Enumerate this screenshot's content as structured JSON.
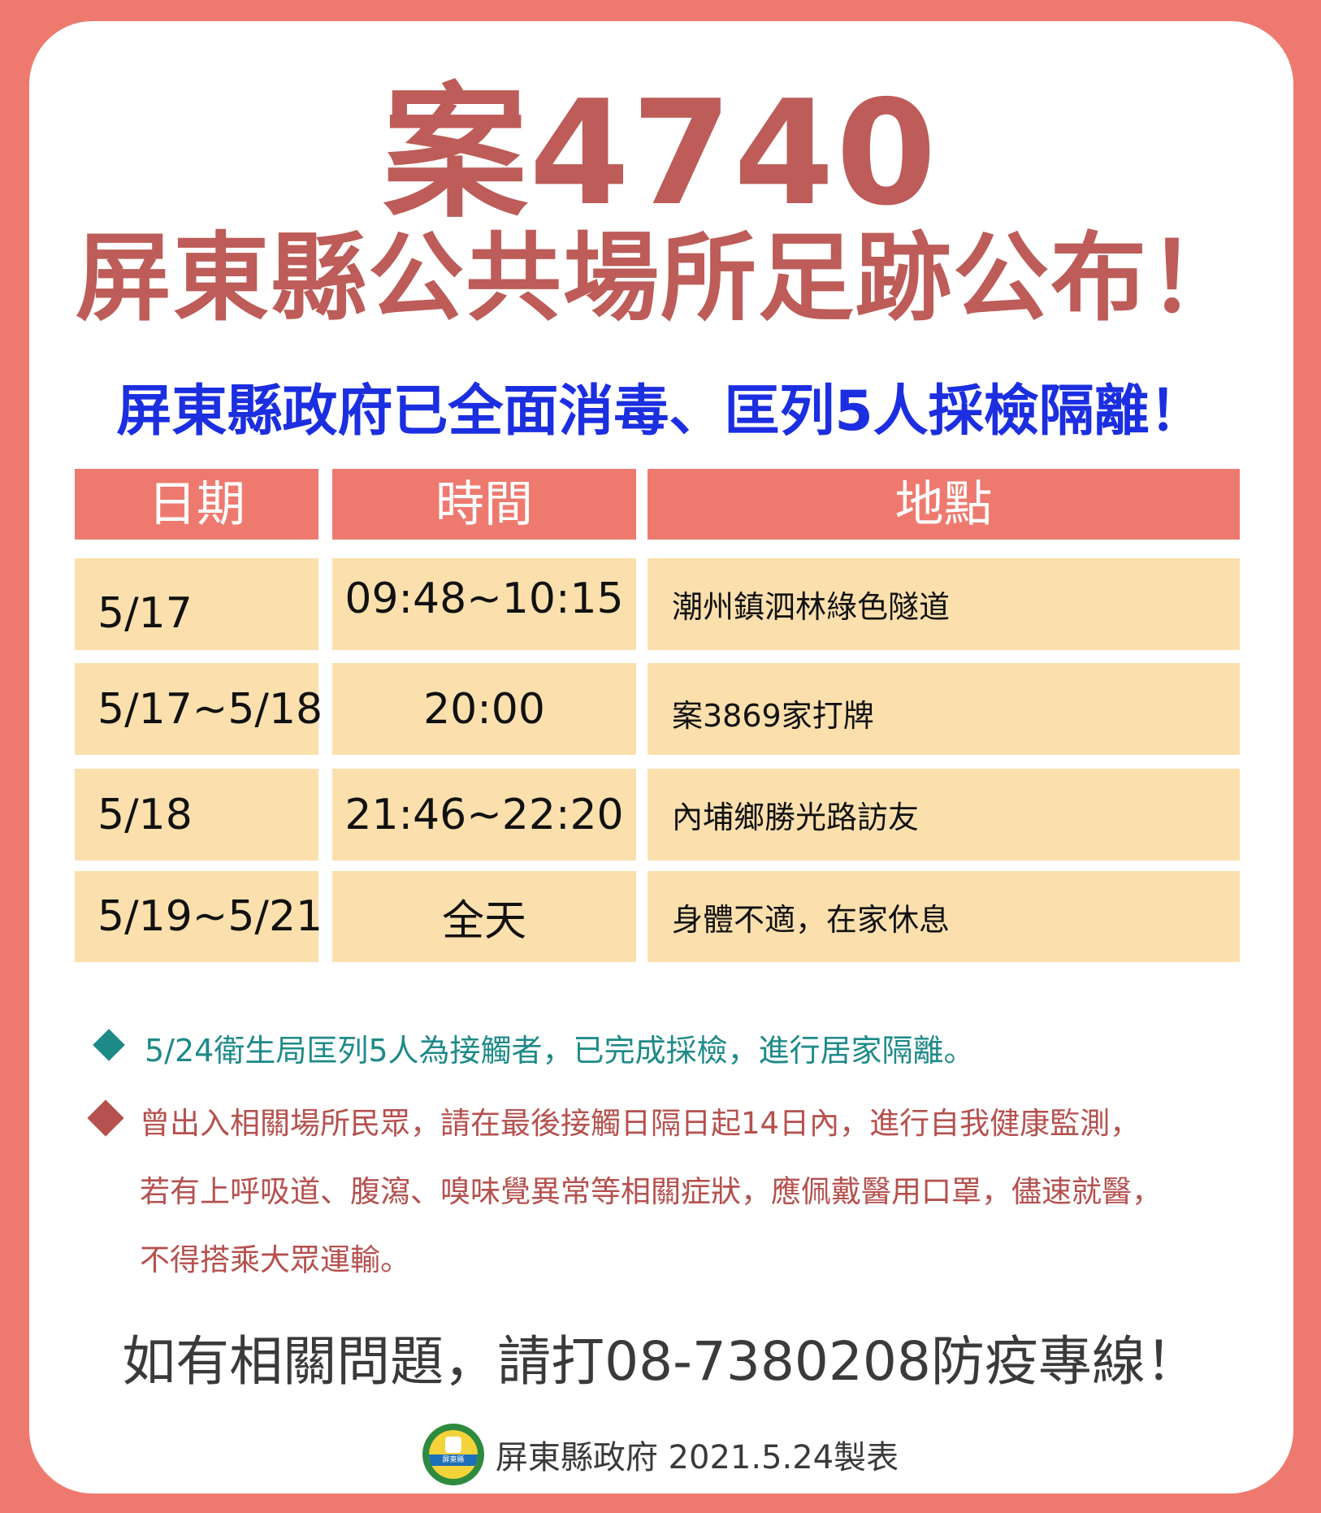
{
  "title": {
    "case": "案4740",
    "main": "屏東縣公共場所足跡公布！"
  },
  "subtitle": "屏東縣政府已全面消毒、匡列5人採檢隔離！",
  "table": {
    "headers": [
      "日期",
      "時間",
      "地點"
    ],
    "rows": [
      {
        "date": "5/17",
        "time": "09:48~10:15",
        "location": "潮州鎮泗林綠色隧道"
      },
      {
        "date": "5/17~5/18",
        "time": "20:00",
        "location": "案3869家打牌"
      },
      {
        "date": "5/18",
        "time": "21:46~22:20",
        "location": "內埔鄉勝光路訪友"
      },
      {
        "date": "5/19~5/21",
        "time": "全天",
        "location": "身體不適，在家休息"
      }
    ]
  },
  "notes": {
    "note1": "5/24衛生局匡列5人為接觸者，已完成採檢，進行居家隔離。",
    "note2_lines": [
      "曾出入相關場所民眾，請在最後接觸日隔日起14日內，進行自我健康監測，",
      "若有上呼吸道、腹瀉、嗅味覺異常等相關症狀，應佩戴醫用口罩，儘速就醫，",
      "不得搭乘大眾運輸。"
    ]
  },
  "hotline": "如有相關問題，請打08-7380208防疫專線！",
  "footer": {
    "seal_text": "屏東縣",
    "credit": "屏東縣政府 2021.5.24製表"
  },
  "colors": {
    "background": "#ee7a6f",
    "title": "#bd5c58",
    "subtitle": "#1b2ee0",
    "table_header": "#ee7a6f",
    "table_row": "#fbe0ad",
    "note_teal": "#1e8a88",
    "note_red": "#b5514e"
  }
}
